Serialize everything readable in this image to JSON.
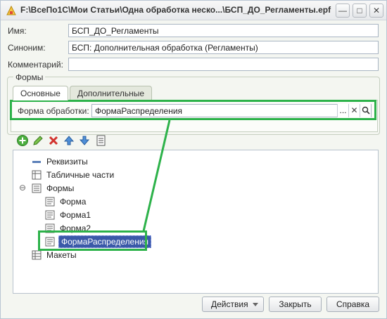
{
  "window": {
    "title": "F:\\ВсеПо1С\\Мои Статьи\\Одна обработка неско...\\БСП_ДО_Регламенты.epf",
    "minimize_label": "—",
    "maximize_label": "□",
    "close_label": "✕"
  },
  "fields": {
    "name": {
      "label": "Имя:",
      "value": "БСП_ДО_Регламенты"
    },
    "synonym": {
      "label": "Синоним:",
      "value": "БСП: Дополнительная обработка (Регламенты)"
    },
    "comment": {
      "label": "Комментарий:",
      "value": ""
    }
  },
  "forms_group": {
    "title": "Формы",
    "tabs": [
      {
        "label": "Основные",
        "active": true
      },
      {
        "label": "Дополнительные",
        "active": false
      }
    ],
    "processing_form": {
      "label": "Форма обработки:",
      "value": "ФормаРаспределения",
      "ellipsis": "...",
      "clear": "✕",
      "search": "⚲"
    }
  },
  "tree": {
    "items": [
      {
        "label": "Реквизиты"
      },
      {
        "label": "Табличные части"
      },
      {
        "label": "Формы",
        "expander": "⊖"
      },
      {
        "label": "Форма"
      },
      {
        "label": "Форма1"
      },
      {
        "label": "Форма2"
      },
      {
        "label": "ФормаРаспределения"
      },
      {
        "label": "Макеты"
      }
    ]
  },
  "buttons": {
    "actions": "Действия",
    "close": "Закрыть",
    "help": "Справка"
  },
  "colors": {
    "highlight": "#2db24a",
    "selection": "#3a59a8"
  }
}
